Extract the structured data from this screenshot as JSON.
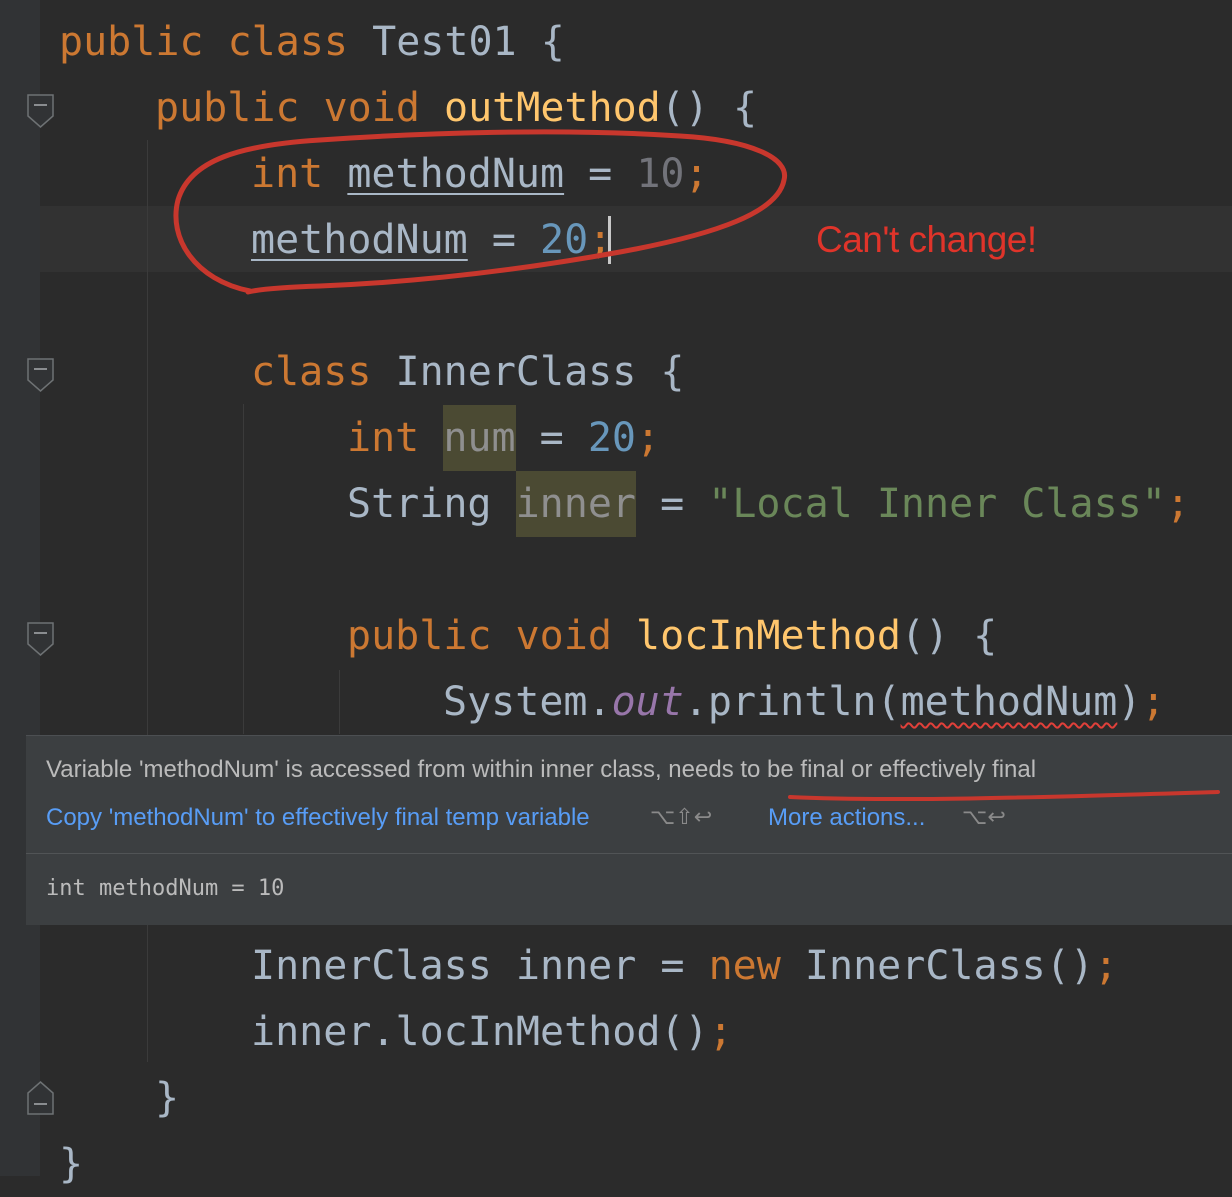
{
  "code": {
    "class_decl": {
      "kw_public": "public",
      "kw_class": "class",
      "name": "Test01",
      "brace": " {"
    },
    "out_method": {
      "kw_public": "public",
      "kw_void": "void",
      "name": "outMethod",
      "rest": "() {"
    },
    "decl_line": {
      "kw_int": "int",
      "var": "methodNum",
      "eq": " = ",
      "value": "10",
      "semi": ";"
    },
    "assign_line": {
      "var": "methodNum",
      "eq": " = ",
      "value": "20",
      "semi": ";"
    },
    "inner_class": {
      "kw_class": "class",
      "name": "InnerClass",
      "brace": " {"
    },
    "field_num": {
      "kw_int": "int",
      "name": "num",
      "eq": " = ",
      "value": "20",
      "semi": ";"
    },
    "field_inner": {
      "type": "String",
      "name": "inner",
      "eq": " = ",
      "value": "\"Local Inner Class\"",
      "semi": ";"
    },
    "loc_method": {
      "kw_public": "public",
      "kw_void": "void",
      "name": "locInMethod",
      "rest": "() {"
    },
    "println_line": {
      "prefix": "System.",
      "field": "out",
      "call": ".println(",
      "arg": "methodNum",
      "close": ")",
      "semi": ";"
    },
    "new_line": {
      "type": "InnerClass",
      "var": " inner = ",
      "kw_new": "new",
      "ctor": " InnerClass()",
      "semi": ";"
    },
    "call_line": {
      "text": "inner.locInMethod()",
      "semi": ";"
    },
    "close_method": "}",
    "close_class": "}"
  },
  "annotation": {
    "text": "Can't change!"
  },
  "popup": {
    "message": "Variable 'methodNum' is accessed from within inner class, needs to be final or effectively final",
    "action_copy": "Copy 'methodNum' to effectively final temp variable",
    "action_copy_shortcut": "⌥⇧↩",
    "action_more": "More actions...",
    "action_more_shortcut": "⌥↩",
    "declaration": "int methodNum = 10"
  },
  "colors": {
    "background": "#2b2b2b",
    "keyword": "#cc7832",
    "method": "#ffc66d",
    "number": "#6897bb",
    "string": "#6a8759",
    "identifier": "#a9b7c6",
    "link": "#589df6",
    "annotation_red": "#e0342a"
  },
  "icons": {
    "fold": "fold-marker-icon"
  }
}
